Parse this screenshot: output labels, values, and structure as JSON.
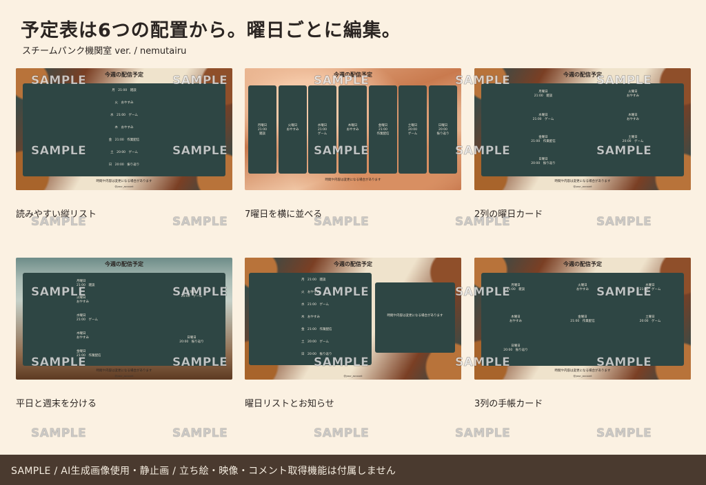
{
  "title": "予定表は6つの配置から。曜日ごとに編集。",
  "subtitle": "スチームパンク機関室 ver. / nemutairu",
  "header_text": "今週の配信予定",
  "footer_note": "時間や内容は変更になる場合があります",
  "handle": "@your_account",
  "watermark": "SAMPLE",
  "captions": [
    "読みやすい縦リスト",
    "7曜日を横に並べる",
    "2列の曜日カード",
    "平日と週末を分ける",
    "曜日リストとお知らせ",
    "3列の手帳カード"
  ],
  "list_entries": [
    "月　21:00　雑談",
    "火　おやすみ",
    "水　21:00　ゲーム",
    "木　おやすみ",
    "金　21:00　作業配信",
    "土　20:00　ゲーム",
    "日　20:00　振り返り"
  ],
  "day_cards": [
    "月曜日\n21:00\n雑談",
    "火曜日\nおやすみ",
    "水曜日\n21:00\nゲーム",
    "木曜日\nおやすみ",
    "金曜日\n21:00\n作業配信",
    "土曜日\n20:00\nゲーム",
    "日曜日\n20:00\n振り返り"
  ],
  "two_col": [
    "月曜日\n21:00　雑談",
    "火曜日\nおやすみ",
    "水曜日\n21:00　ゲーム",
    "木曜日\nおやすみ",
    "金曜日\n21:00　作業配信",
    "土曜日\n20:00　ゲーム",
    "日曜日\n20:00　振り返り"
  ],
  "weekday_weekend": {
    "weekdays": [
      "月曜日\n21:00　雑談",
      "火曜日\nおやすみ",
      "水曜日\n21:00　ゲーム",
      "木曜日\nおやすみ",
      "金曜日\n21:00　作業配信"
    ],
    "weekend": [
      "土曜日\n20:00　ゲーム",
      "日曜日\n20:00　振り返り"
    ]
  },
  "three_col": [
    "月曜日\n21:00　雑談",
    "火曜日\nおやすみ",
    "水曜日\n21:00　ゲーム",
    "木曜日\nおやすみ",
    "金曜日\n21:00　作業配信",
    "土曜日\n20:00　ゲーム",
    "日曜日\n20:00　振り返り"
  ],
  "bottom_bar": "SAMPLE / AI生成画像使用・静止画 / 立ち絵・映像・コメント取得機能は付属しません"
}
